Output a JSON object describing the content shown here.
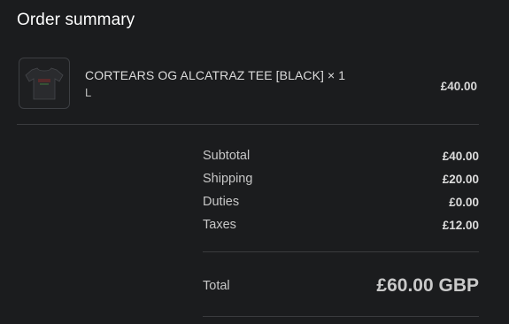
{
  "order": {
    "title": "Order summary",
    "item": {
      "name": "CORTEARS OG ALCATRAZ TEE [BLACK] × 1",
      "variant": "L",
      "price": "£40.00",
      "thumbnail_icon": "tshirt-thumbnail"
    },
    "totals": [
      {
        "label": "Subtotal",
        "value": "£40.00"
      },
      {
        "label": "Shipping",
        "value": "£20.00"
      },
      {
        "label": "Duties",
        "value": "£0.00"
      },
      {
        "label": "Taxes",
        "value": "£12.00"
      }
    ],
    "grand_total": {
      "label": "Total",
      "value": "£60.00 GBP"
    }
  },
  "colors": {
    "background": "#1b1c1e",
    "divider": "#3a3b3e",
    "text": "#dcdcdc"
  }
}
